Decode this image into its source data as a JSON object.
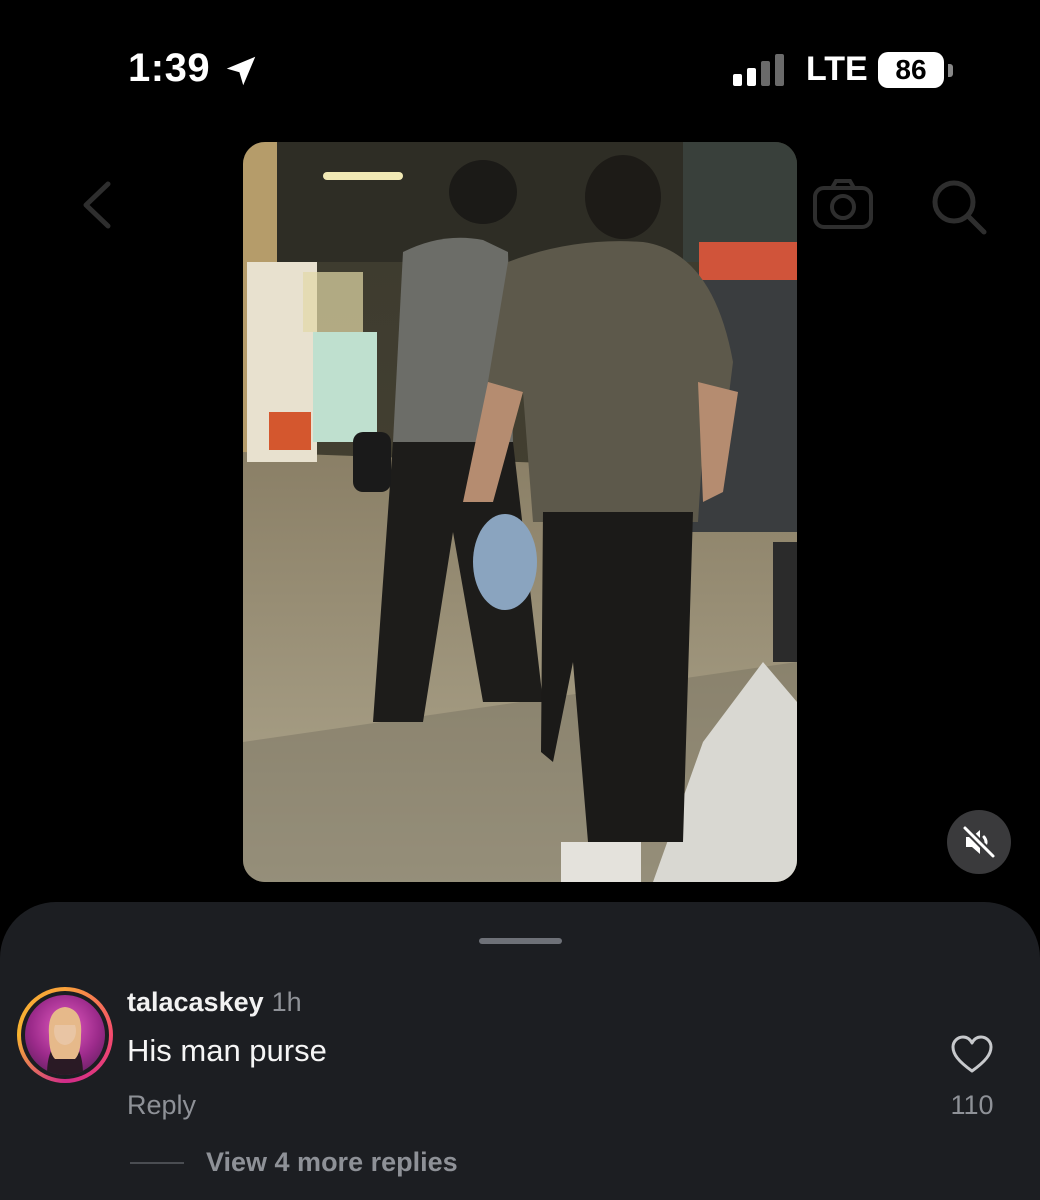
{
  "status_bar": {
    "time": "1:39",
    "location_icon": "location-arrow-icon",
    "signal_icon": "signal-bars-icon",
    "network": "LTE",
    "battery": "86"
  },
  "header": {
    "back_icon": "chevron-left-icon",
    "camera_icon": "camera-icon",
    "search_icon": "search-icon"
  },
  "video": {
    "mute_icon": "speaker-muted-icon"
  },
  "comment": {
    "username": "talacaskey",
    "time": "1h",
    "text": "His man purse",
    "reply_label": "Reply",
    "like_icon": "heart-outline-icon",
    "like_count": "110",
    "view_replies_label": "View 4 more replies"
  },
  "colors": {
    "background": "#000000",
    "sheet": "#1c1e22",
    "secondary_text": "#8e9197"
  }
}
